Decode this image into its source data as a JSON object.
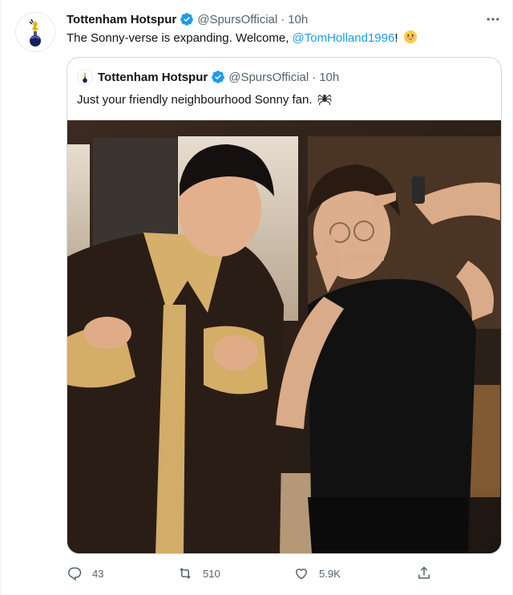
{
  "tweet": {
    "author_name": "Tottenham Hotspur",
    "handle": "@SpursOfficial",
    "time": "10h",
    "text_prefix": "The Sonny-verse is expanding. Welcome, ",
    "mention": "@TomHolland1996",
    "text_suffix": "!",
    "emoji": "grinning-face-emoji"
  },
  "quoted": {
    "author_name": "Tottenham Hotspur",
    "handle": "@SpursOfficial",
    "time": "10h",
    "text": "Just your friendly neighbourhood Sonny fan.",
    "emoji": "spider-emoji"
  },
  "actions": {
    "replies": "43",
    "retweets": "510",
    "likes": "5.9K"
  },
  "colors": {
    "accent": "#1d9bf0",
    "muted": "#536471",
    "border": "#cfd9de",
    "spurs_navy": "#132257"
  }
}
